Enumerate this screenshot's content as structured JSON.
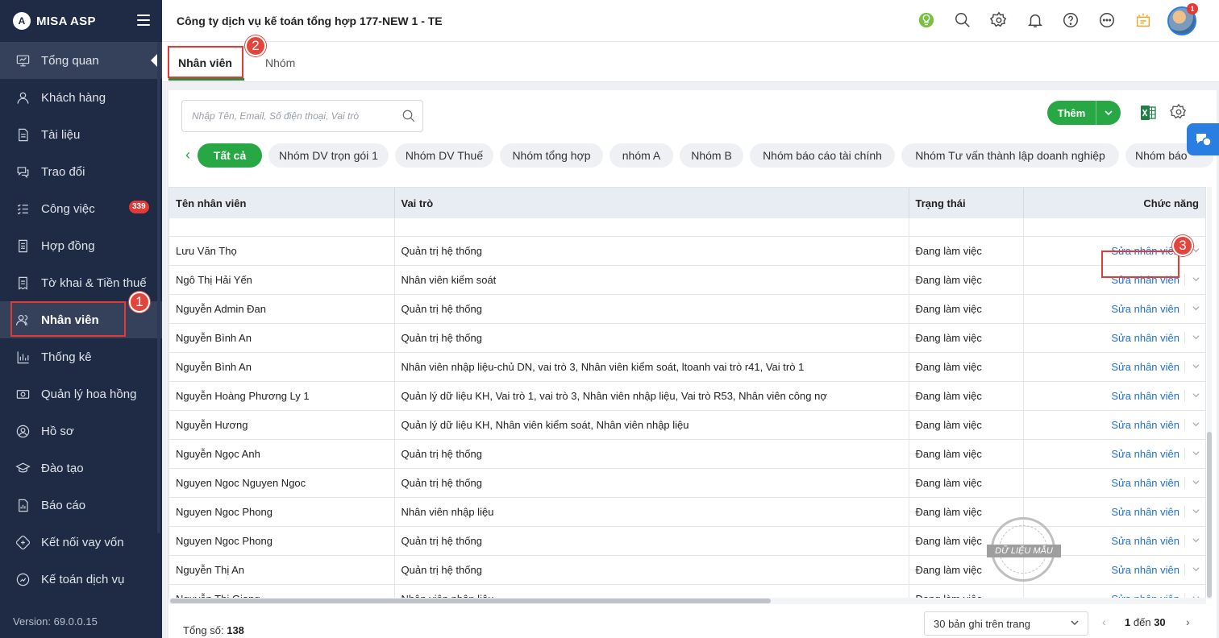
{
  "app": {
    "logo_mark": "A",
    "logo_text": "MISA ASP",
    "version": "Version: 69.0.0.15"
  },
  "sidebar": {
    "items": [
      {
        "label": "Tổng quan",
        "icon": "dashboard-icon"
      },
      {
        "label": "Khách hàng",
        "icon": "user-icon"
      },
      {
        "label": "Tài liệu",
        "icon": "document-icon"
      },
      {
        "label": "Trao đổi",
        "icon": "chat-icon"
      },
      {
        "label": "Công việc",
        "icon": "checklist-icon",
        "badge": "339"
      },
      {
        "label": "Hợp đồng",
        "icon": "contract-icon"
      },
      {
        "label": "Tờ khai & Tiền thuế",
        "icon": "tax-icon"
      },
      {
        "label": "Nhân viên",
        "icon": "users-icon"
      },
      {
        "label": "Thống kê",
        "icon": "chart-icon"
      },
      {
        "label": "Quản lý hoa hồng",
        "icon": "money-icon"
      },
      {
        "label": "Hồ sơ",
        "icon": "profile-icon"
      },
      {
        "label": "Đào tạo",
        "icon": "training-icon"
      },
      {
        "label": "Báo cáo",
        "icon": "report-icon"
      },
      {
        "label": "Kết nối vay vốn",
        "icon": "loan-icon"
      },
      {
        "label": "Kế toán dịch vụ",
        "icon": "accounting-icon"
      }
    ]
  },
  "header": {
    "company": "Công ty dịch vụ kế toán tổng hợp 177-NEW 1 - TE",
    "notification_count": "1"
  },
  "tabs": [
    {
      "label": "Nhân viên"
    },
    {
      "label": "Nhóm"
    }
  ],
  "callouts": [
    "1",
    "2",
    "3"
  ],
  "toolbar": {
    "search_placeholder": "Nhập Tên, Email, Số điện thoại, Vai trò",
    "add_label": "Thêm"
  },
  "groups": [
    "Tất cả",
    "Nhóm DV trọn gói 1",
    "Nhóm DV Thuế",
    "Nhóm tổng hợp",
    "nhóm A",
    "Nhóm B",
    "Nhóm báo cáo tài chính",
    "Nhóm Tư vấn thành lập doanh nghiệp",
    "Nhóm báo"
  ],
  "table": {
    "columns": [
      "Tên nhân viên",
      "Vai trò",
      "Trạng thái",
      "Chức năng"
    ],
    "edit_label": "Sửa nhân viên",
    "rows": [
      {
        "name": "Lưu Văn Thọ",
        "role": "Quản trị hệ thống",
        "status": "Đang làm việc"
      },
      {
        "name": "Ngô Thị Hải Yến",
        "role": "Nhân viên kiểm soát",
        "status": "Đang làm việc"
      },
      {
        "name": "Nguyễn Admin Đan",
        "role": "Quản trị hệ thống",
        "status": "Đang làm việc"
      },
      {
        "name": "Nguyễn Bình An",
        "role": "Quản trị hệ thống",
        "status": "Đang làm việc"
      },
      {
        "name": "Nguyễn Bình An",
        "role": "Nhân viên nhập liệu-chủ DN, vai trò 3, Nhân viên kiểm soát, ltoanh vai trò r41, Vai trò 1",
        "status": "Đang làm việc"
      },
      {
        "name": "Nguyễn Hoàng Phương Ly 1",
        "role": "Quản lý dữ liệu KH, Vai trò 1, vai trò 3, Nhân viên nhập liệu, Vai trò R53, Nhân viên công nợ",
        "status": "Đang làm việc"
      },
      {
        "name": "Nguyễn Hương",
        "role": "Quản lý dữ liệu KH, Nhân viên kiểm soát, Nhân viên nhập liệu",
        "status": "Đang làm việc"
      },
      {
        "name": "Nguyễn Ngọc Anh",
        "role": "Quản trị hệ thống",
        "status": "Đang làm việc"
      },
      {
        "name": "Nguyen Ngoc Nguyen Ngoc",
        "role": "Quản trị hệ thống",
        "status": "Đang làm việc"
      },
      {
        "name": "Nguyen Ngoc Phong",
        "role": "Nhân viên nhập liệu",
        "status": "Đang làm việc"
      },
      {
        "name": "Nguyen Ngoc Phong",
        "role": "Quản trị hệ thống",
        "status": "Đang làm việc"
      },
      {
        "name": "Nguyễn Thị An",
        "role": "Quản trị hệ thống",
        "status": "Đang làm việc"
      },
      {
        "name": "Nguyễn Thị Giang",
        "role": "Nhân viên nhập liệu",
        "status": "Đang làm việc"
      }
    ]
  },
  "watermark": "DỮ LIỆU MẪU",
  "footer": {
    "total_label": "Tổng số:",
    "total_value": "138",
    "page_size": "30 bản ghi trên trang",
    "range_from": "1",
    "range_sep": "đến",
    "range_to": "30"
  }
}
